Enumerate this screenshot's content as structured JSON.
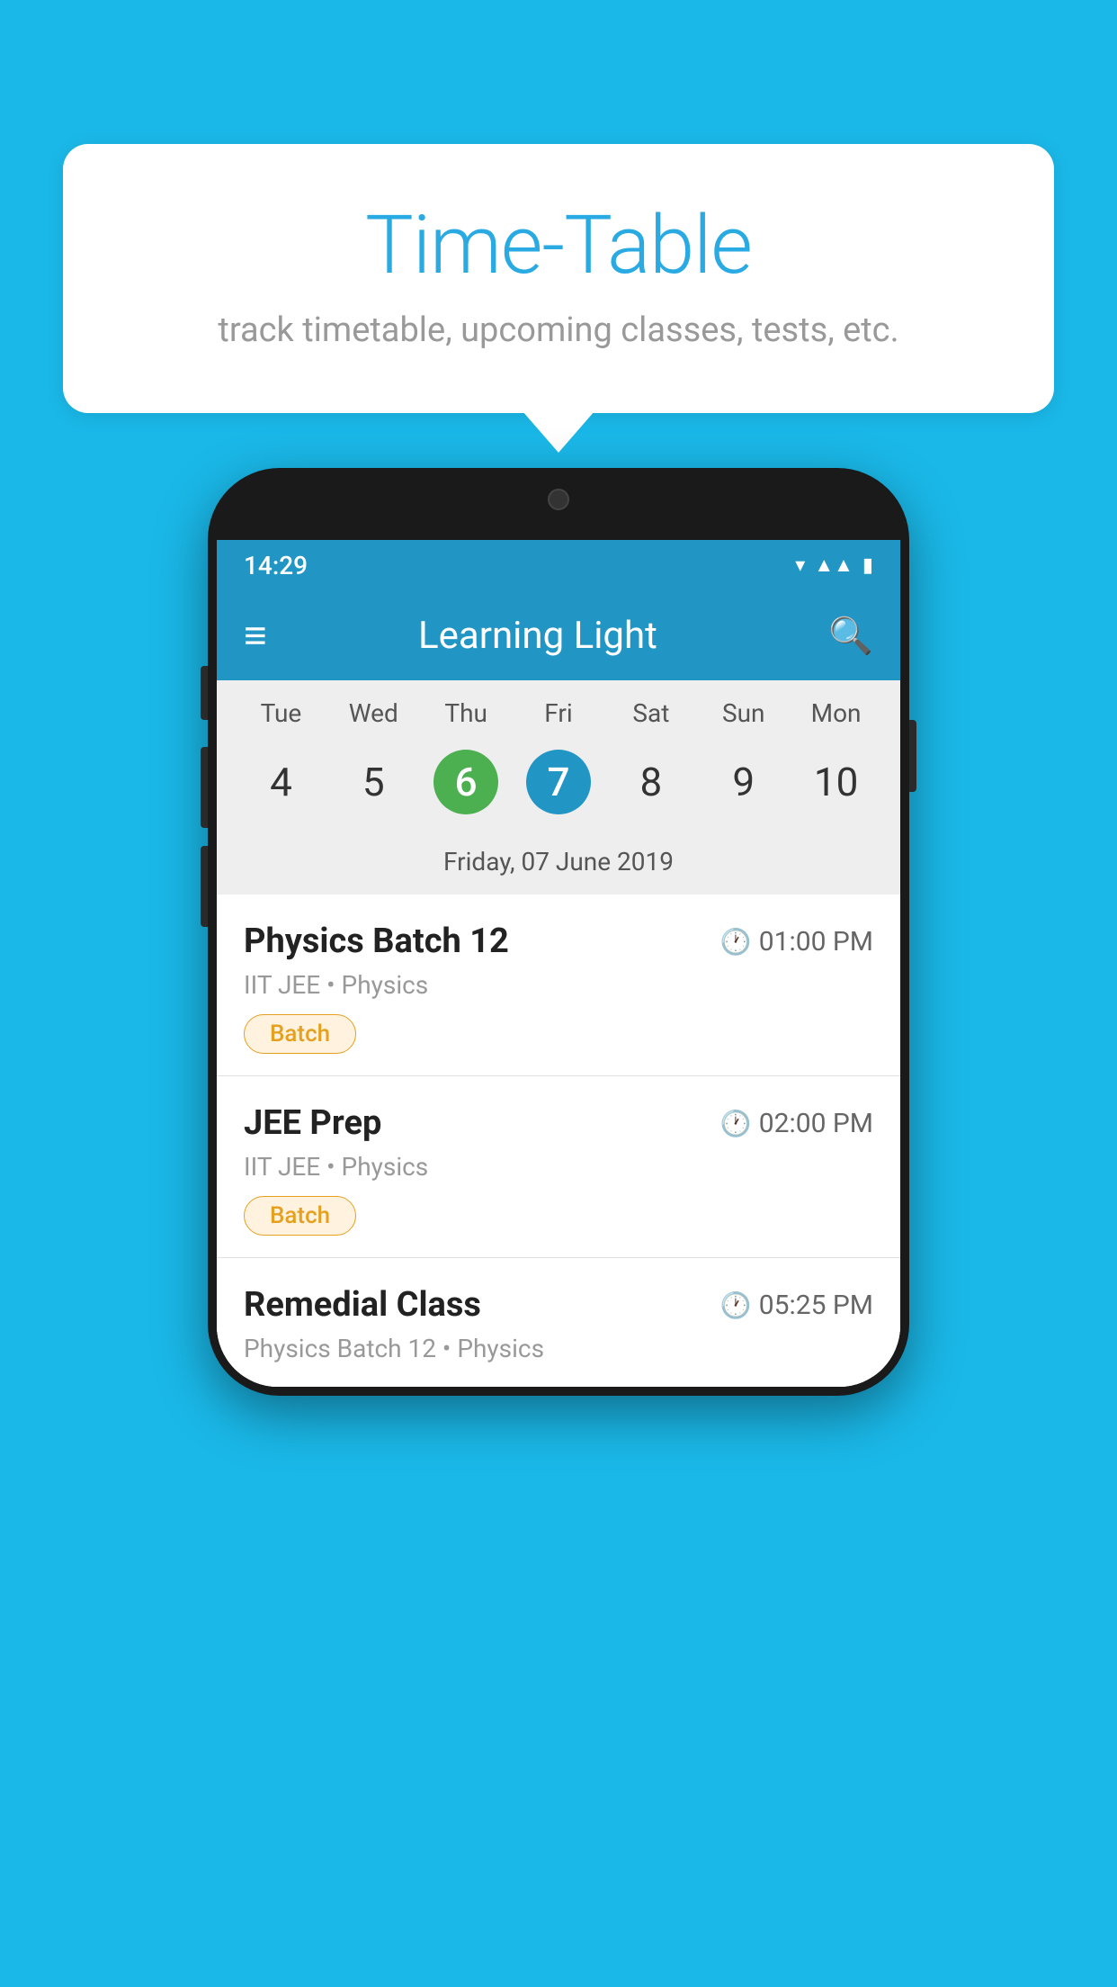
{
  "background_color": "#1ab8e8",
  "bubble": {
    "title": "Time-Table",
    "subtitle": "track timetable, upcoming classes, tests, etc."
  },
  "status_bar": {
    "time": "14:29"
  },
  "app_bar": {
    "title": "Learning Light"
  },
  "calendar": {
    "day_headers": [
      "Tue",
      "Wed",
      "Thu",
      "Fri",
      "Sat",
      "Sun",
      "Mon"
    ],
    "day_numbers": [
      "4",
      "5",
      "6",
      "7",
      "8",
      "9",
      "10"
    ],
    "today_index": 2,
    "selected_index": 3,
    "selected_date_label": "Friday, 07 June 2019"
  },
  "classes": [
    {
      "name": "Physics Batch 12",
      "time": "01:00 PM",
      "subtitle": "IIT JEE • Physics",
      "badge": "Batch"
    },
    {
      "name": "JEE Prep",
      "time": "02:00 PM",
      "subtitle": "IIT JEE • Physics",
      "badge": "Batch"
    },
    {
      "name": "Remedial Class",
      "time": "05:25 PM",
      "subtitle": "Physics Batch 12 • Physics",
      "badge": null
    }
  ],
  "icons": {
    "hamburger": "≡",
    "search": "🔍",
    "clock": "🕐"
  }
}
